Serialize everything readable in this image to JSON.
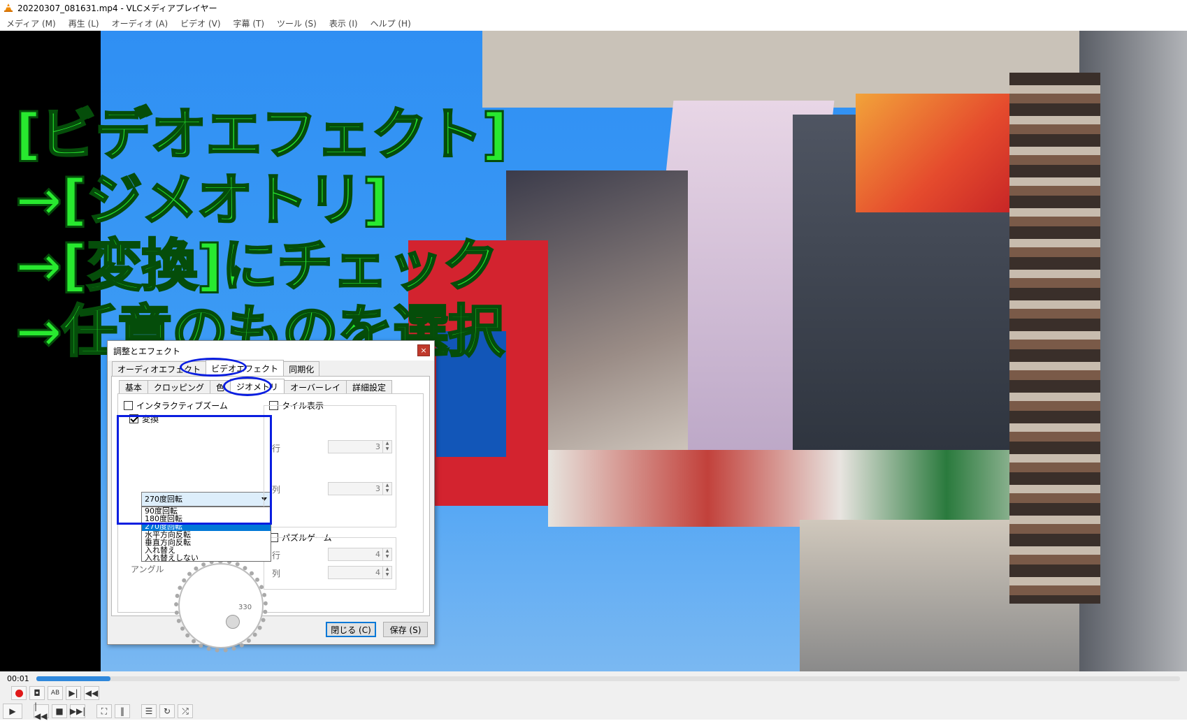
{
  "window": {
    "title": "20220307_081631.mp4 - VLCメディアプレイヤー"
  },
  "menu": [
    "メディア (M)",
    "再生 (L)",
    "オーディオ (A)",
    "ビデオ (V)",
    "字幕 (T)",
    "ツール (S)",
    "表示 (I)",
    "ヘルプ (H)"
  ],
  "caption": {
    "line1": "[ビデオエフェクト]",
    "line2": "→[ジメオトリ]",
    "line3": "→[変換]にチェック",
    "line4": "→任意のものを選択"
  },
  "dialog": {
    "title": "調整とエフェクト",
    "close": "×",
    "tabs": [
      "オーディオエフェクト",
      "ビデオエフェクト",
      "同期化"
    ],
    "active_tab": "ビデオエフェクト",
    "subtabs": [
      "基本",
      "クロッピング",
      "色",
      "ジオメトリ",
      "オーバーレイ",
      "詳細設定"
    ],
    "active_subtab": "ジオメトリ",
    "interactive_zoom": "インタラクティブズーム",
    "transform": "変換",
    "transform_checked": true,
    "combo_value": "270度回転",
    "options": [
      "90度回転",
      "180度回転",
      "270度回転",
      "水平方向反転",
      "垂直方向反転",
      "入れ替え",
      "入れ替えしない"
    ],
    "selected_option": "270度回転",
    "angle_label": "アングル",
    "angle_value": "330",
    "tile": {
      "label": "タイル表示",
      "row_label": "行",
      "row_value": "3",
      "col_label": "列",
      "col_value": "3"
    },
    "puzzle": {
      "label": "パズルゲーム",
      "row_label": "行",
      "row_value": "4",
      "col_label": "列",
      "col_value": "4"
    },
    "close_button": "閉じる (C)",
    "save_button": "保存 (S)"
  },
  "player": {
    "time": "00:01",
    "progress_fraction": 0.065
  },
  "colors": {
    "caption_text": "#28e92f",
    "highlight": "#0a1ee0",
    "seek_fill": "#2f88dc"
  }
}
